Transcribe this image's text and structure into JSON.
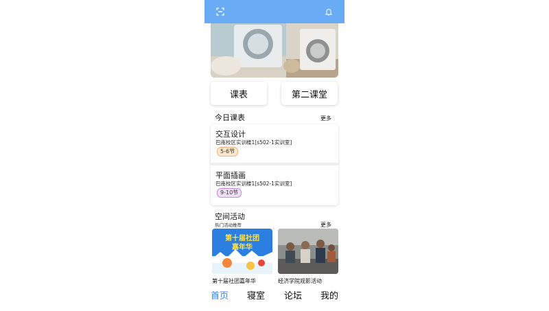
{
  "topbar": {
    "color": "#6aabf5",
    "left_icon": "scan-icon",
    "right_icon": "bell-icon"
  },
  "buttons": {
    "schedule": "课表",
    "second_class": "第二课堂"
  },
  "today": {
    "title": "今日课表",
    "more": "更多",
    "courses": [
      {
        "name": "交互设计",
        "location": "巴南校区实训楼1[s502-1实训室]",
        "period": "5-6节"
      },
      {
        "name": "平面插画",
        "location": "巴南校区实训楼1[s502-1实训室]",
        "period": "9-10节"
      }
    ]
  },
  "activities": {
    "title": "空间活动",
    "subtitle": "热门活动推荐",
    "more": "更多",
    "items": [
      {
        "caption": "第十届社团嘉年华",
        "poster_text": "第十届社团嘉年华"
      },
      {
        "caption": "经济学院观影活动"
      }
    ]
  },
  "nav": {
    "home": "首页",
    "dorm": "寝室",
    "forum": "论坛",
    "mine": "我的",
    "active_color": "#3b82f6"
  }
}
